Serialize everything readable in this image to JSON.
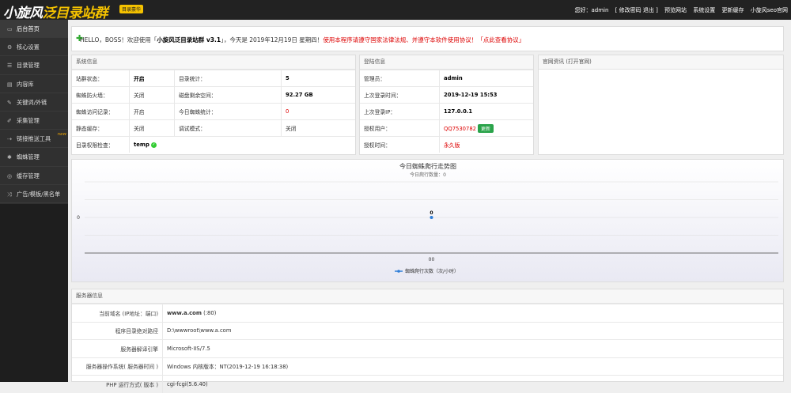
{
  "header": {
    "logo_main": "小旋风",
    "logo_sub": "泛目录站群",
    "logo_badge": "目录豪华",
    "greeting": "您好：admin",
    "change_pwd": "[ 修改密码 退出 ]",
    "nav": [
      "预览网站",
      "系统设置",
      "更新缓存",
      "小旋风seo官网"
    ]
  },
  "sidebar": {
    "items": [
      {
        "label": "后台首页",
        "icon": "monitor-icon"
      },
      {
        "label": "核心设置",
        "icon": "gear-icon"
      },
      {
        "label": "目录管理",
        "icon": "list-icon"
      },
      {
        "label": "内容库",
        "icon": "book-icon"
      },
      {
        "label": "关键词/外链",
        "icon": "key-icon"
      },
      {
        "label": "采集管理",
        "icon": "pencil-icon"
      },
      {
        "label": "链接推送工具",
        "icon": "push-icon",
        "badge": "new"
      },
      {
        "label": "蜘蛛管理",
        "icon": "spider-icon"
      },
      {
        "label": "缓存管理",
        "icon": "cache-icon"
      },
      {
        "label": "广告/模板/黑名单",
        "icon": "shuffle-icon"
      }
    ]
  },
  "welcome": {
    "hello": "HELLO，BOSS！欢迎使用「",
    "product": "小旋风泛目录站群 v3.1",
    "date": "」，今天是 2019年12月19日 星期四！",
    "warning": "使用本程序请遵守国家法律法规、并遵守本软件使用协议！",
    "agreement": "「点此查看协议」"
  },
  "sysinfo": {
    "title": "系统信息",
    "rows": [
      [
        "站群状态：",
        "开启",
        "目录统计：",
        "5"
      ],
      [
        "蜘蛛防火墙：",
        "关闭",
        "磁盘剩余空间：",
        "92.27 GB"
      ],
      [
        "蜘蛛访问记录：",
        "开启",
        "今日蜘蛛统计：",
        "0"
      ],
      [
        "静态缓存：",
        "关闭",
        "调试模式：",
        "关闭"
      ]
    ],
    "perm_label": "目录权限检查：",
    "perm_value": "temp"
  },
  "login": {
    "title": "登陆信息",
    "rows": [
      [
        "管理员：",
        "admin"
      ],
      [
        "上次登录时间：",
        "2019-12-19 15:53"
      ],
      [
        "上次登录IP：",
        "127.0.0.1"
      ],
      [
        "授权用户：",
        "QQ7530782"
      ],
      [
        "授权时间：",
        "永久版"
      ]
    ],
    "update_btn": "更新"
  },
  "news": {
    "title": "官网资讯 (打开官网)"
  },
  "chart_data": {
    "type": "line",
    "title": "今日蜘蛛爬行走势图",
    "subtitle": "今日爬行数量：0",
    "categories": [
      "00"
    ],
    "series": [
      {
        "name": "蜘蛛爬行次数（次/小时）",
        "values": [
          0
        ]
      }
    ],
    "y_tick_labels": [
      "0"
    ],
    "data_labels": [
      "0"
    ],
    "legend": "bottom",
    "color": "#2f7ed8"
  },
  "server": {
    "title": "服务器信息",
    "rows": [
      [
        "当前域名 (IP地址：端口)",
        "www.a.com",
        " (:80)"
      ],
      [
        "程序目录绝对路径",
        "D:\\wwwroot\\www.a.com",
        ""
      ],
      [
        "服务器解译引擎",
        "Microsoft-IIS/7.5",
        ""
      ],
      [
        "服务器操作系统( 服务器时间 )",
        "Windows 内核版本：NT(2019-12-19 16:18:38)",
        ""
      ],
      [
        "PHP 运行方式( 版本 )",
        "cgi-fcgi(5.6.40)",
        ""
      ]
    ]
  }
}
